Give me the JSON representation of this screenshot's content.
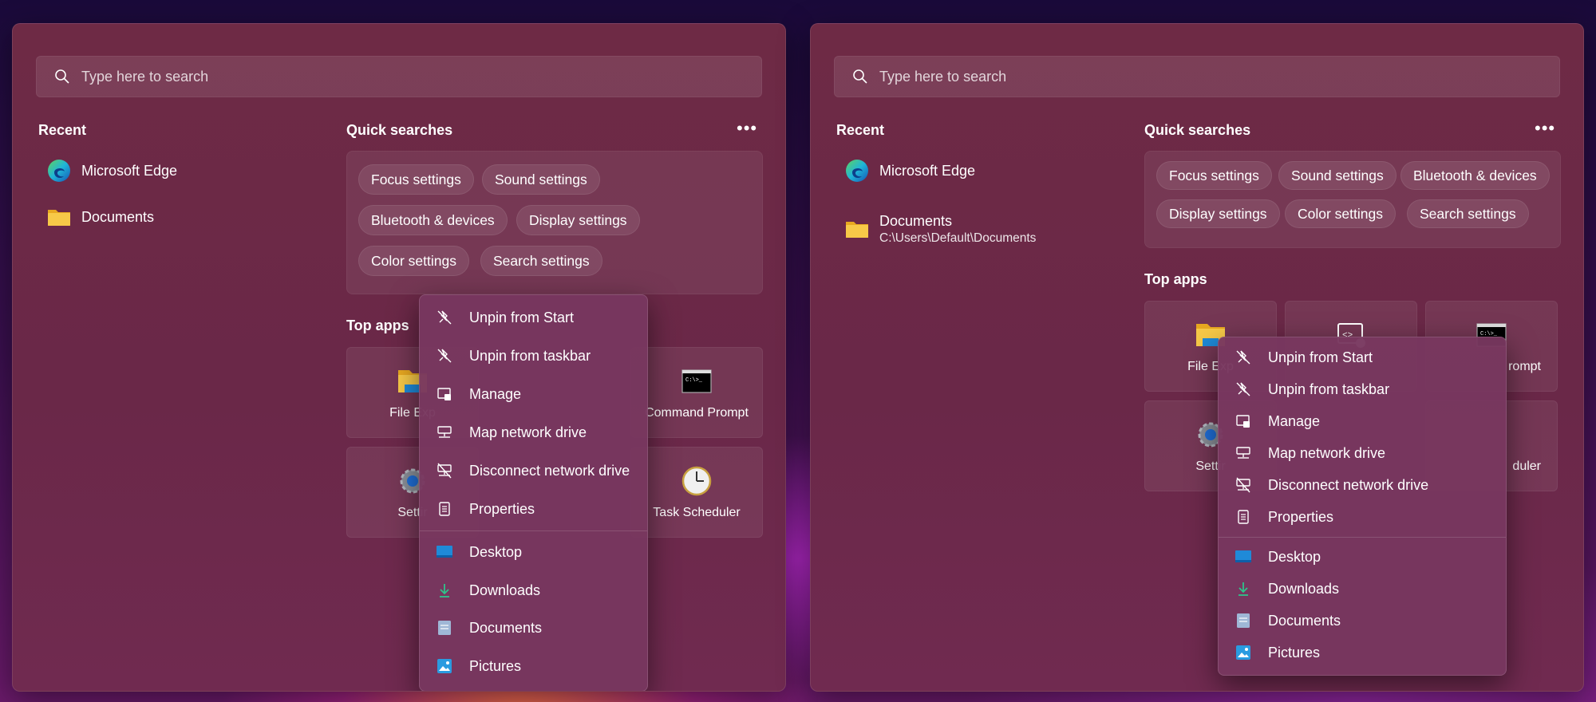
{
  "left_panel": {
    "search": {
      "placeholder": "Type here to search"
    },
    "recent": {
      "title": "Recent",
      "items": [
        {
          "label": "Microsoft Edge",
          "icon": "edge-icon"
        },
        {
          "label": "Documents",
          "icon": "folder-icon"
        }
      ]
    },
    "quick_searches": {
      "title": "Quick searches",
      "more": "•••",
      "chips": [
        "Focus settings",
        "Sound settings",
        "Bluetooth & devices",
        "Display settings",
        "Color settings",
        "Search settings"
      ]
    },
    "top_apps": {
      "title": "Top apps",
      "tiles": [
        "File Exp",
        "Command Prompt",
        "Settir",
        "Task Scheduler"
      ]
    },
    "context_menu": {
      "items": [
        "Unpin from Start",
        "Unpin from taskbar",
        "Manage",
        "Map network drive",
        "Disconnect network drive",
        "Properties"
      ],
      "places": [
        "Desktop",
        "Downloads",
        "Documents",
        "Pictures"
      ]
    }
  },
  "right_panel": {
    "search": {
      "placeholder": "Type here to search"
    },
    "recent": {
      "title": "Recent",
      "items": [
        {
          "label": "Microsoft Edge",
          "icon": "edge-icon"
        },
        {
          "label": "Documents",
          "sub": "C:\\Users\\Default\\Documents",
          "icon": "folder-icon"
        }
      ]
    },
    "quick_searches": {
      "title": "Quick searches",
      "more": "•••",
      "chips": [
        "Focus settings",
        "Sound settings",
        "Bluetooth & devices",
        "Display settings",
        "Color settings",
        "Search settings"
      ]
    },
    "top_apps": {
      "title": "Top apps",
      "tiles": [
        "File Exp",
        "rompt",
        "Settir",
        "duler"
      ]
    },
    "context_menu": {
      "items": [
        "Unpin from Start",
        "Unpin from taskbar",
        "Manage",
        "Map network drive",
        "Disconnect network drive",
        "Properties"
      ],
      "places": [
        "Desktop",
        "Downloads",
        "Documents",
        "Pictures"
      ]
    }
  },
  "colors": {
    "panel": "#6e2a45",
    "menu": "#78375f",
    "edge_blue": "#1f9ad8",
    "edge_green": "#5fd35f",
    "folder_yellow": "#f7c948"
  }
}
